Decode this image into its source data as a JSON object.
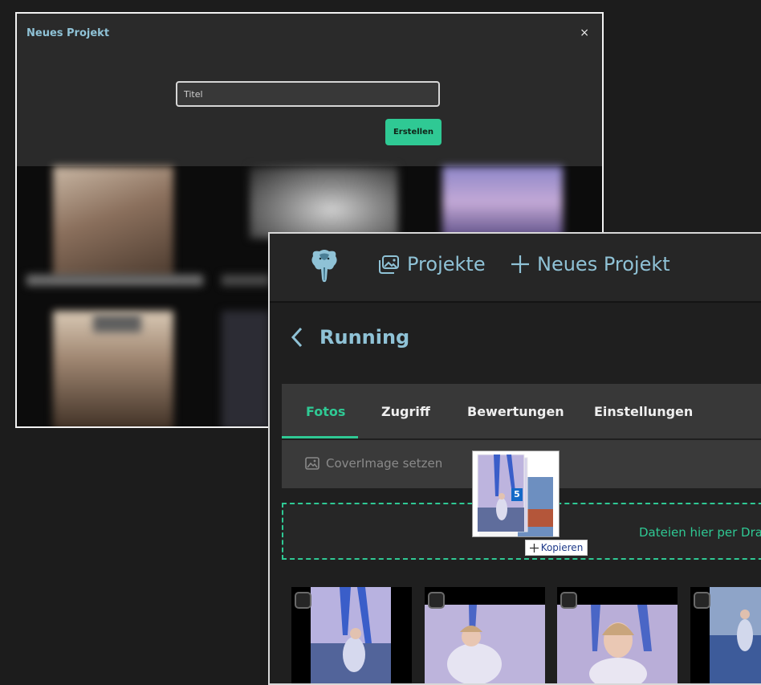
{
  "modal": {
    "title": "Neues Projekt",
    "close_label": "×",
    "title_placeholder": "Titel",
    "create_label": "Erstellen"
  },
  "app": {
    "nav": {
      "projects_label": "Projekte",
      "new_project_label": "Neues Projekt"
    },
    "project_title": "Running",
    "tabs": [
      {
        "label": "Fotos",
        "active": true
      },
      {
        "label": "Zugriff",
        "active": false
      },
      {
        "label": "Bewertungen",
        "active": false
      },
      {
        "label": "Einstellungen",
        "active": false
      }
    ],
    "toolbar": {
      "cover_label": "CoverImage setzen"
    },
    "dropzone": {
      "text": "Dateien hier per Drag"
    }
  },
  "drag": {
    "count": "5",
    "copy_label": "Kopieren"
  },
  "colors": {
    "accent_blue": "#8fc2d6",
    "accent_green": "#2fc994",
    "badge_blue": "#1469c7"
  },
  "icons": [
    "elephant-logo-icon",
    "image-gallery-icon",
    "plus-icon",
    "back-chevron-icon",
    "image-icon",
    "close-icon",
    "checkbox-icon"
  ]
}
